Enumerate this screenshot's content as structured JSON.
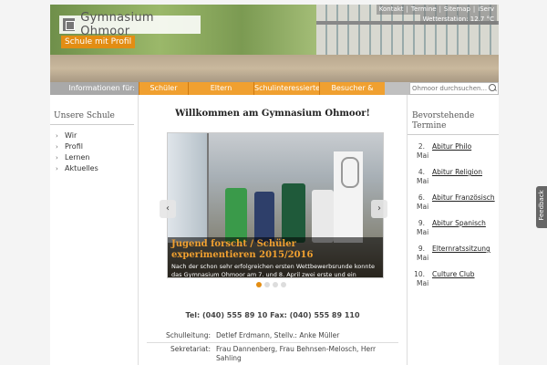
{
  "header": {
    "logo_title": "Gymnasium Ohmoor",
    "tagline": "Schule mit Profil",
    "top_links": [
      "Kontakt",
      "Termine",
      "Sitemap",
      "iServ"
    ],
    "weather": "Wetterstation: 12.7 °C"
  },
  "nav": {
    "label": "Informationen für:",
    "items": [
      "Schüler",
      "Eltern",
      "Schulinteressierte",
      "Besucher & Partner"
    ],
    "search_placeholder": "Ohmoor durchsuchen..."
  },
  "sidebar": {
    "title": "Unsere Schule",
    "items": [
      "Wir",
      "Profil",
      "Lernen",
      "Aktuelles"
    ]
  },
  "main": {
    "heading": "Willkommen am Gymnasium Ohmoor!",
    "slider": {
      "title": "Jugend forscht / Schüler experimentieren 2015/2016",
      "text": "Nach der schon sehr erfolgreichen ersten Wettbewerbsrunde konnte das Gymnasium Ohmoor am 7. und 8. April zwei erste und ein zweiter Preis auf",
      "slide_count": 4,
      "active_index": 0
    },
    "contact": "Tel: (040) 555 89 10 Fax: (040) 555 89 110",
    "info": [
      {
        "key": "Schulleitung:",
        "value": "Detlef Erdmann, Stellv.: Anke Müller"
      },
      {
        "key": "Sekretariat:",
        "value": "Frau Dannenberg, Frau Behnsen-Melosch, Herr Sahling"
      }
    ]
  },
  "events": {
    "title": "Bevorstehende Termine",
    "items": [
      {
        "day": "2.",
        "month": "Mai",
        "title": "Abitur Philo"
      },
      {
        "day": "4.",
        "month": "Mai",
        "title": "Abitur Religion"
      },
      {
        "day": "6.",
        "month": "Mai",
        "title": "Abitur Französisch"
      },
      {
        "day": "9.",
        "month": "Mai",
        "title": "Abitur Spanisch"
      },
      {
        "day": "9.",
        "month": "Mai",
        "title": "Elternratssitzung"
      },
      {
        "day": "10.",
        "month": "Mai",
        "title": "Culture Club"
      }
    ]
  },
  "feedback_label": "Feedback",
  "colors": {
    "accent": "#e38d13",
    "nav": "#f0a030"
  }
}
